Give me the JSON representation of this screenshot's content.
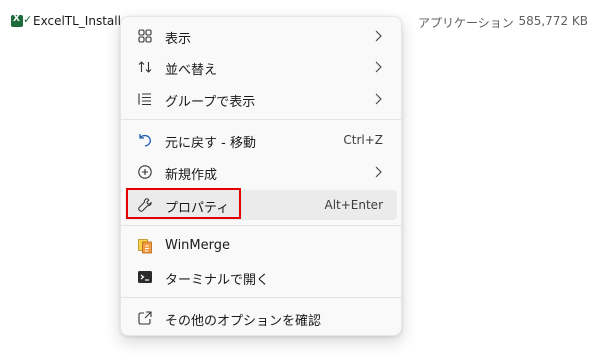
{
  "file": {
    "name": "ExcelTL_Installer",
    "type": "アプリケーション",
    "size": "585,772 KB",
    "icon": "excel-installer-icon"
  },
  "menu": {
    "items": [
      {
        "label": "表示",
        "icon": "view-grid-icon",
        "submenu": true
      },
      {
        "label": "並べ替え",
        "icon": "sort-icon",
        "submenu": true
      },
      {
        "label": "グループで表示",
        "icon": "group-list-icon",
        "submenu": true
      },
      {
        "label": "元に戻す - 移動",
        "icon": "undo-icon",
        "shortcut": "Ctrl+Z"
      },
      {
        "label": "新規作成",
        "icon": "new-plus-icon",
        "submenu": true
      },
      {
        "label": "プロパティ",
        "icon": "wrench-icon",
        "shortcut": "Alt+Enter",
        "hovered": true,
        "highlighted": true
      },
      {
        "label": "WinMerge",
        "icon": "winmerge-icon"
      },
      {
        "label": "ターミナルで開く",
        "icon": "terminal-icon"
      },
      {
        "label": "その他のオプションを確認",
        "icon": "share-more-icon"
      }
    ]
  },
  "colors": {
    "highlight_border": "#e50000",
    "menu_background": "#f9f9f9",
    "hover_background": "#ebebeb",
    "excel_green": "#1e6b3c"
  }
}
